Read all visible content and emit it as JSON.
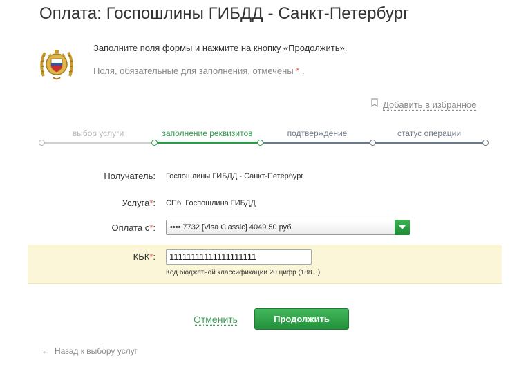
{
  "page": {
    "title": "Оплата: Госпошлины ГИБДД - Санкт-Петербург"
  },
  "intro": {
    "line1": "Заполните поля формы и нажмите на кнопку «Продолжить».",
    "line2": "Поля, обязательные для заполнения, отмечены",
    "required_mark": "*",
    "line2_end": "."
  },
  "favorites": {
    "label": "Добавить в избранное",
    "icon": "bookmark-icon"
  },
  "steps": [
    {
      "label": "выбор услуги",
      "state": "done"
    },
    {
      "label": "заполнение реквизитов",
      "state": "active"
    },
    {
      "label": "подтверждение",
      "state": "todo"
    },
    {
      "label": "статус операции",
      "state": "todo"
    }
  ],
  "form": {
    "recipient_label": "Получатель:",
    "recipient_value": "Госпошлины ГИБДД - Санкт-Петербург",
    "service_label": "Услуга",
    "service_value": "СПб. Госпошлина ГИБДД",
    "payment_label": "Оплата с",
    "payment_value": "•••• 7732 [Visa Classic] 4049.50 руб.",
    "kbk_label": "КБК",
    "kbk_value": "11111111111111111111",
    "kbk_hint": "Код бюджетной классификации 20 цифр (188...)",
    "required_mark": "*",
    "colon": ":"
  },
  "actions": {
    "cancel_label": "Отменить",
    "continue_label": "Продолжить",
    "back_label": "Назад к выбору услуг",
    "back_arrow": "←"
  },
  "colors": {
    "accent_green": "#2c9a4a",
    "button_green": "#22903b",
    "highlight_band": "#fcf6d8",
    "required_red": "#d9534f"
  }
}
